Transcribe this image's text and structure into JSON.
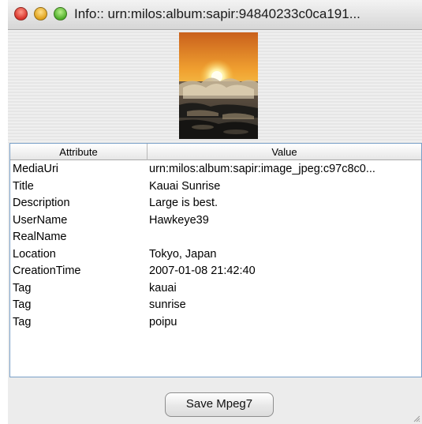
{
  "window": {
    "title": "Info:: urn:milos:album:sapir:94840233c0ca191..."
  },
  "table": {
    "headers": {
      "attribute": "Attribute",
      "value": "Value"
    },
    "rows": [
      {
        "attribute": "MediaUri",
        "value": "urn:milos:album:sapir:image_jpeg:c97c8c0..."
      },
      {
        "attribute": "Title",
        "value": "Kauai Sunrise"
      },
      {
        "attribute": "Description",
        "value": "Large is best."
      },
      {
        "attribute": "UserName",
        "value": "Hawkeye39"
      },
      {
        "attribute": "RealName",
        "value": ""
      },
      {
        "attribute": "Location",
        "value": "Tokyo, Japan"
      },
      {
        "attribute": "CreationTime",
        "value": "2007-01-08 21:42:40"
      },
      {
        "attribute": "Tag",
        "value": "kauai"
      },
      {
        "attribute": "Tag",
        "value": "sunrise"
      },
      {
        "attribute": "Tag",
        "value": "poipu"
      }
    ]
  },
  "actions": {
    "save_label": "Save Mpeg7"
  },
  "colors": {
    "table_border": "#7aa0c8",
    "window_bg": "#ececec"
  }
}
